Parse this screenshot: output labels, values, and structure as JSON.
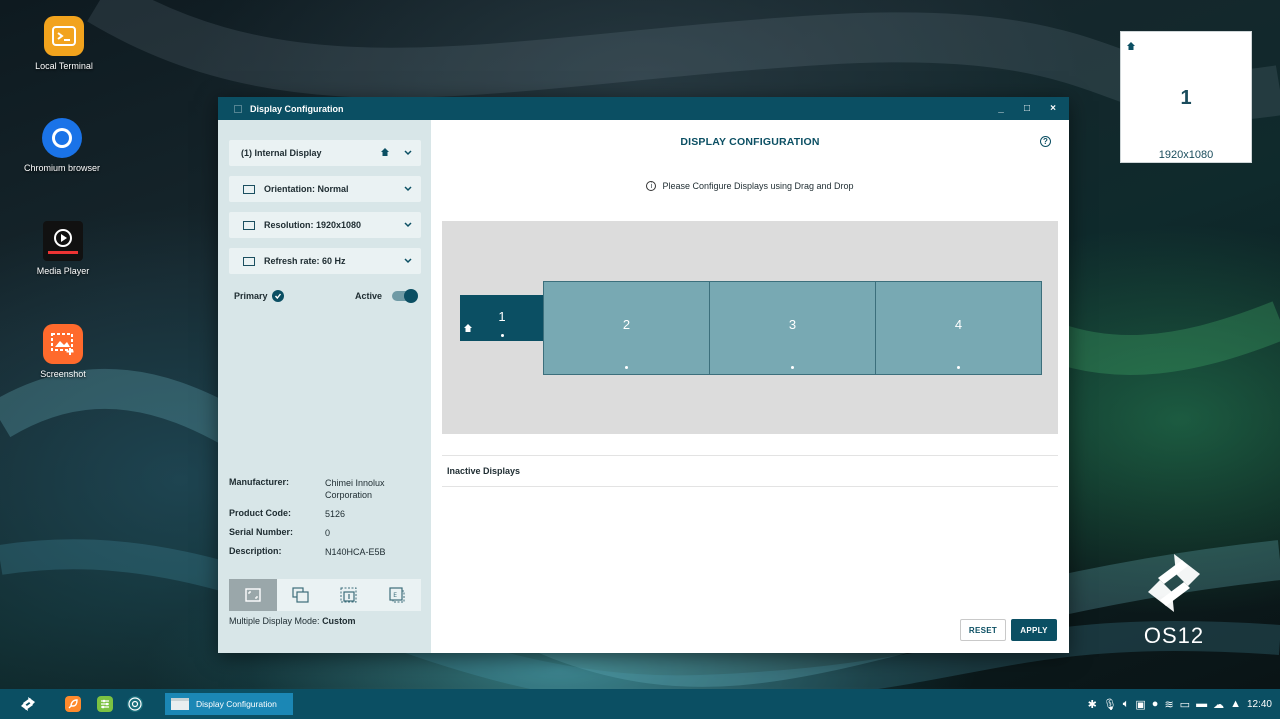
{
  "desktop": {
    "icons": [
      {
        "label": "Local Terminal",
        "icon": "terminal-icon",
        "color": "#f2a31d"
      },
      {
        "label": "Chromium browser",
        "icon": "chromium-icon",
        "color": "#1a73e8"
      },
      {
        "label": "Media Player",
        "icon": "media-player-icon",
        "color": "#111111"
      },
      {
        "label": "Screenshot",
        "icon": "screenshot-icon",
        "color": "#ff6a2c"
      }
    ],
    "preview": {
      "number": "1",
      "resolution": "1920x1080"
    },
    "brand": "OS12"
  },
  "window": {
    "title": "Display Configuration",
    "controls": [
      "_",
      "□",
      "×"
    ]
  },
  "sidebar": {
    "display_select": "(1) Internal Display",
    "orientation": "Orientation: Normal",
    "resolution": "Resolution: 1920x1080",
    "refresh_rate": "Refresh rate: 60 Hz",
    "primary_label": "Primary",
    "active_label": "Active",
    "info": {
      "manufacturer_label": "Manufacturer:",
      "manufacturer": "Chimei Innolux Corporation",
      "product_code_label": "Product Code:",
      "product_code": "5126",
      "serial_label": "Serial Number:",
      "serial": "0",
      "description_label": "Description:",
      "description": "N140HCA-E5B"
    },
    "mode_label": "Multiple Display Mode:",
    "mode_value": "Custom"
  },
  "main": {
    "title": "DISPLAY CONFIGURATION",
    "hint": "Please Configure Displays using Drag and Drop",
    "displays": [
      {
        "label": "1",
        "primary": true
      },
      {
        "label": "2",
        "primary": false
      },
      {
        "label": "3",
        "primary": false
      },
      {
        "label": "4",
        "primary": false
      }
    ],
    "inactive_header": "Inactive Displays",
    "reset": "RESET",
    "apply": "APPLY"
  },
  "taskbar": {
    "active_task": "Display Configuration",
    "clock": "12:40"
  },
  "colors": {
    "accent": "#0b4f63",
    "display_fill": "#78a9b3",
    "taskbar": "#0b4f63"
  }
}
